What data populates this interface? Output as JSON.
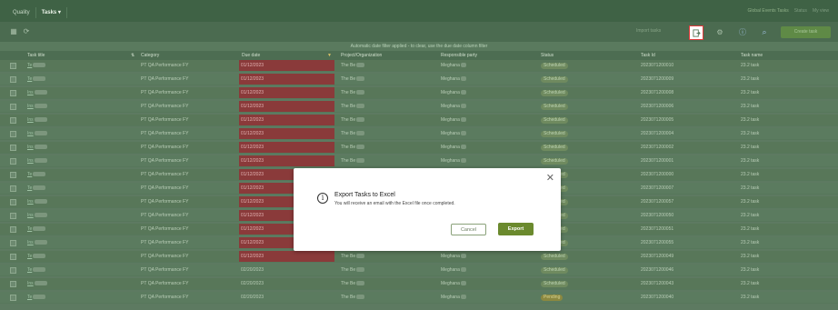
{
  "topbar": {
    "tabs": [
      "Quality",
      "Tasks ▾"
    ],
    "right": [
      "Global Events Tasks",
      "Status",
      "My view"
    ]
  },
  "toolbar": {
    "import_label": "Import tasks",
    "create_label": "Create task",
    "icons": [
      "export-icon",
      "settings-icon",
      "info-icon",
      "search-icon"
    ]
  },
  "notice": "Automatic date filter applied - to clear, use the due date column filter",
  "table": {
    "headers": [
      "Task title",
      "Category",
      "Due date",
      "Project/Organization",
      "Responsible party",
      "Status",
      "Task Id",
      "Task name"
    ],
    "rows": [
      {
        "title": "Te",
        "category": "PT QA Performance FY",
        "due": "01/12/2023",
        "project": "The Be",
        "party": "Meghana",
        "status": "Scheduled",
        "id": "2023071200010",
        "name": "23.2 task"
      },
      {
        "title": "Te",
        "category": "PT QA Performance FY",
        "due": "01/12/2023",
        "project": "The Be",
        "party": "Meghana",
        "status": "Scheduled",
        "id": "2023071200009",
        "name": "23.2 task"
      },
      {
        "title": "Ins",
        "category": "PT QA Performance FY",
        "due": "01/12/2023",
        "project": "The Be",
        "party": "Meghana",
        "status": "Scheduled",
        "id": "2023071200008",
        "name": "23.2 task"
      },
      {
        "title": "Ins",
        "category": "PT QA Performance FY",
        "due": "01/12/2023",
        "project": "The Be",
        "party": "Meghana",
        "status": "Scheduled",
        "id": "2023071200006",
        "name": "23.2 task"
      },
      {
        "title": "Ins",
        "category": "PT QA Performance FY",
        "due": "01/12/2023",
        "project": "The Be",
        "party": "Meghana",
        "status": "Scheduled",
        "id": "2023071200005",
        "name": "23.2 task"
      },
      {
        "title": "Ins",
        "category": "PT QA Performance FY",
        "due": "01/12/2023",
        "project": "The Be",
        "party": "Meghana",
        "status": "Scheduled",
        "id": "2023071200004",
        "name": "23.2 task"
      },
      {
        "title": "Ins",
        "category": "PT QA Performance FY",
        "due": "01/12/2023",
        "project": "The Be",
        "party": "Meghana",
        "status": "Scheduled",
        "id": "2023071200002",
        "name": "23.2 task"
      },
      {
        "title": "Ins",
        "category": "PT QA Performance FY",
        "due": "01/12/2023",
        "project": "The Be",
        "party": "Meghana",
        "status": "Scheduled",
        "id": "2023071200001",
        "name": "23.2 task"
      },
      {
        "title": "Te",
        "category": "PT QA Performance FY",
        "due": "01/12/2023",
        "project": "The Be",
        "party": "Meghana",
        "status": "Scheduled",
        "id": "2023071200000",
        "name": "23.2 task"
      },
      {
        "title": "Te",
        "category": "PT QA Performance FY",
        "due": "01/12/2023",
        "project": "The Be",
        "party": "Meghana",
        "status": "Scheduled",
        "id": "2023071200007",
        "name": "23.2 task"
      },
      {
        "title": "Ins",
        "category": "PT QA Performance FY",
        "due": "01/12/2023",
        "project": "The Be",
        "party": "Meghana",
        "status": "Scheduled",
        "id": "2023071200057",
        "name": "23.2 task"
      },
      {
        "title": "Ins",
        "category": "PT QA Performance FY",
        "due": "01/12/2023",
        "project": "The Be",
        "party": "Meghana",
        "status": "Scheduled",
        "id": "2023071200050",
        "name": "23.2 task"
      },
      {
        "title": "Te",
        "category": "PT QA Performance FY",
        "due": "01/12/2023",
        "project": "The Be",
        "party": "Meghana",
        "status": "Scheduled",
        "id": "2023071200051",
        "name": "23.2 task"
      },
      {
        "title": "Ins",
        "category": "PT QA Performance FY",
        "due": "01/12/2023",
        "project": "The Be",
        "party": "Meghana",
        "status": "Scheduled",
        "id": "2023071200055",
        "name": "23.2 task"
      },
      {
        "title": "Te",
        "category": "PT QA Performance FY",
        "due": "01/12/2023",
        "project": "The Be",
        "party": "Meghana",
        "status": "Scheduled",
        "id": "2023071200049",
        "name": "23.2 task"
      },
      {
        "title": "Te",
        "category": "PT QA Performance FY",
        "due": "02/20/2023",
        "project": "The Be",
        "party": "Meghana",
        "status": "Scheduled",
        "id": "2023071200046",
        "name": "23.2 task"
      },
      {
        "title": "Ins",
        "category": "PT QA Performance FY",
        "due": "02/20/2023",
        "project": "The Be",
        "party": "Meghana",
        "status": "Scheduled",
        "id": "2023071200043",
        "name": "23.2 task"
      },
      {
        "title": "Te",
        "category": "PT QA Performance FY",
        "due": "02/20/2023",
        "project": "The Be",
        "party": "Meghana",
        "status": "Pending",
        "id": "2023071200040",
        "name": "23.2 task"
      }
    ]
  },
  "modal": {
    "title": "Export Tasks to Excel",
    "message": "You will receive an email with the Excel file once completed.",
    "cancel_label": "Cancel",
    "export_label": "Export",
    "close_glyph": "✕",
    "info_glyph": "i"
  }
}
